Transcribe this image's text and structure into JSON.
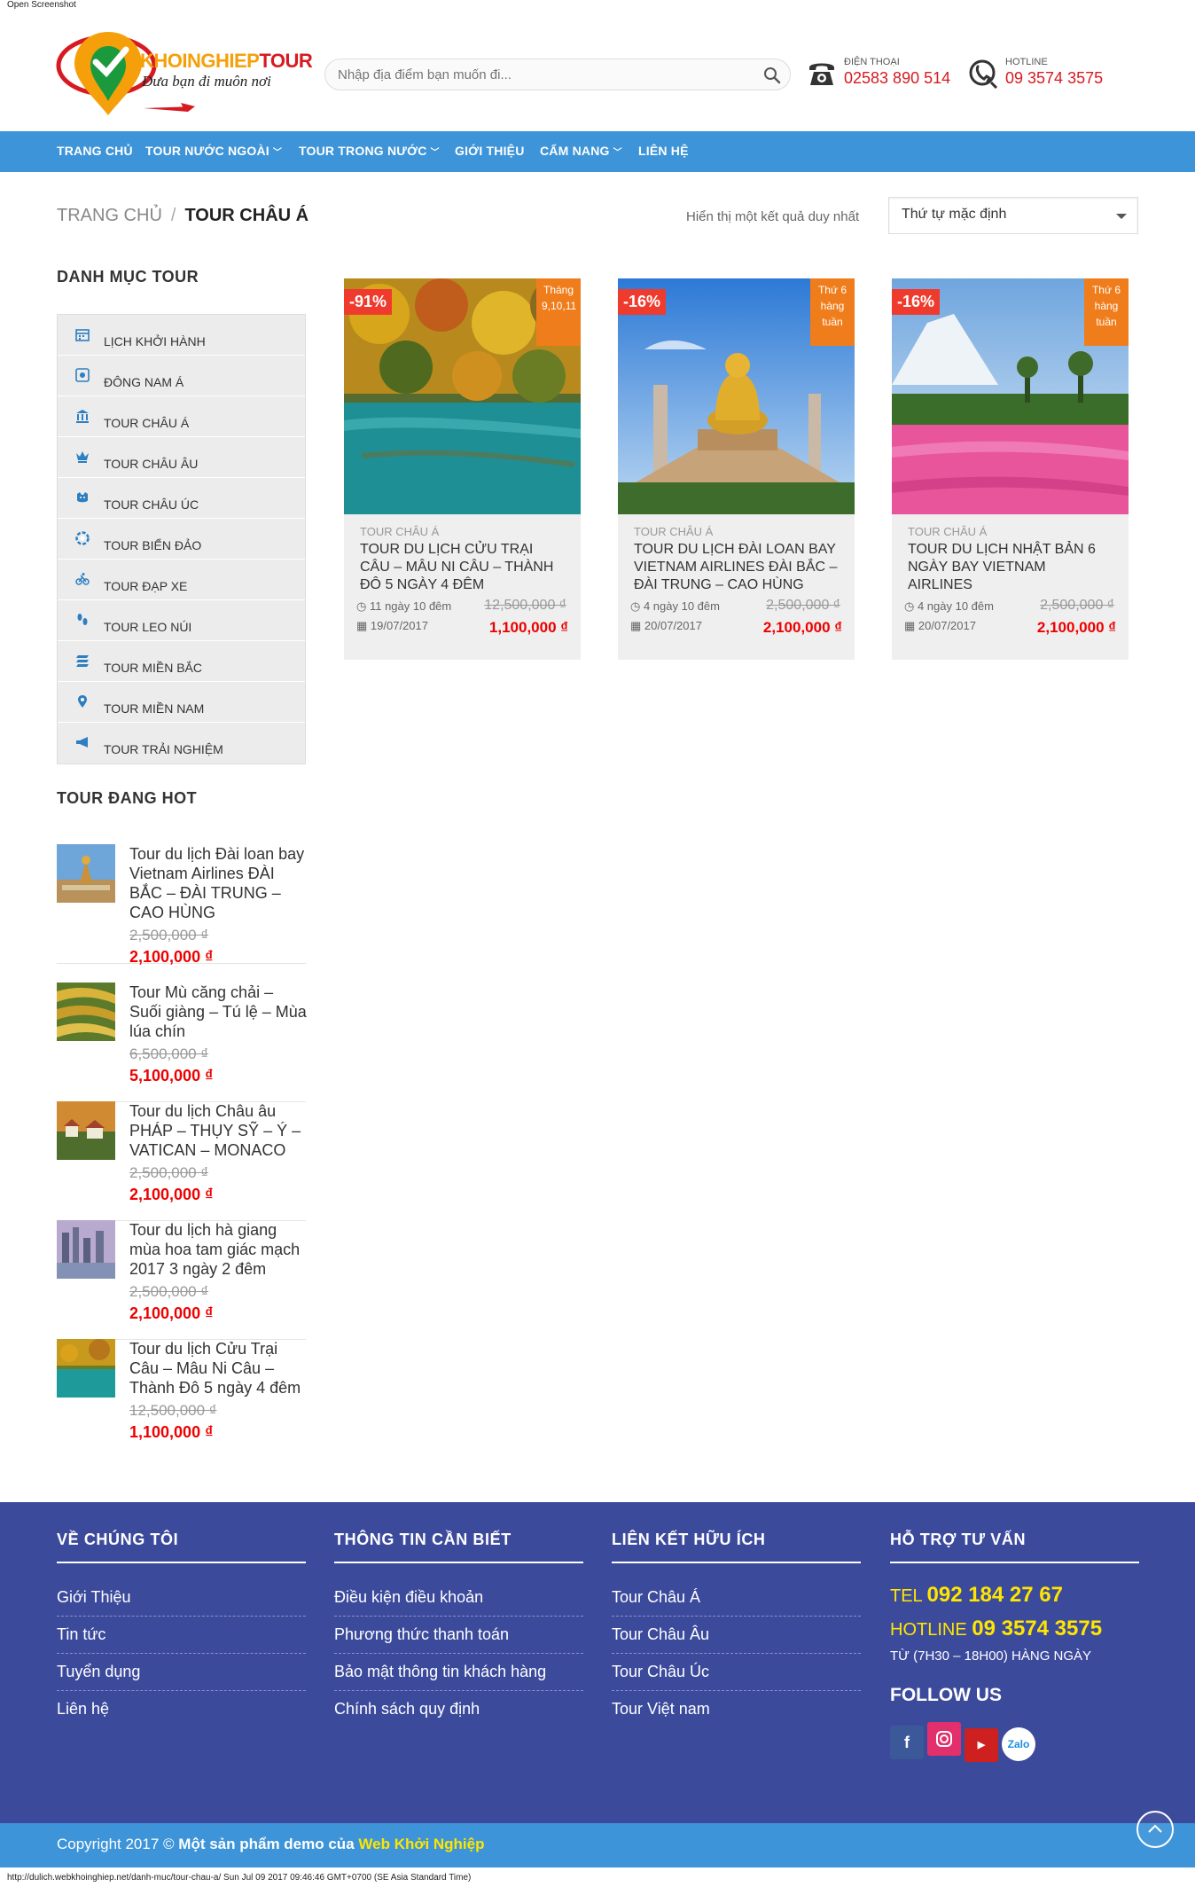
{
  "window": {
    "caption": "Open Screenshot",
    "status_line": "http://dulich.webkhoinghiep.net/danh-muc/tour-chau-a/ Sun Jul 09 2017 09:46:46 GMT+0700 (SE Asia Standard Time)"
  },
  "header": {
    "logo_title_a": "KHOINGHIEP",
    "logo_title_b": "TOUR",
    "logo_slogan": "Đưa bạn đi muôn nơi",
    "search_placeholder": "Nhập địa điểm bạn muốn đi...",
    "phone_label": "ĐIỆN THOẠI",
    "phone_number": "02583 890 514",
    "hotline_label": "HOTLINE",
    "hotline_number": "09 3574 3575"
  },
  "nav": [
    {
      "label": "TRANG CHỦ",
      "dropdown": false
    },
    {
      "label": "TOUR NƯỚC NGOÀI",
      "dropdown": true
    },
    {
      "label": "TOUR TRONG NƯỚC",
      "dropdown": true
    },
    {
      "label": "GIỚI THIỆU",
      "dropdown": false
    },
    {
      "label": "CẨM NANG",
      "dropdown": true
    },
    {
      "label": "LIÊN HỆ",
      "dropdown": false
    }
  ],
  "breadcrumb": {
    "home": "TRANG CHỦ",
    "separator": "/",
    "current": "TOUR CHÂU Á"
  },
  "result_count": "Hiển thị một kết quả duy nhất",
  "sort": {
    "selected": "Thứ tự mặc định"
  },
  "sidebar": {
    "categories_title": "DANH MỤC TOUR",
    "categories": [
      {
        "label": "LỊCH KHỞI HÀNH",
        "icon": "calendar-icon"
      },
      {
        "label": "ĐÔNG NAM Á",
        "icon": "map-pin-square-icon"
      },
      {
        "label": "TOUR CHÂU Á",
        "icon": "bank-icon"
      },
      {
        "label": "TOUR CHÂU ÂU",
        "icon": "crown-icon"
      },
      {
        "label": "TOUR CHÂU ÚC",
        "icon": "kangaroo-icon"
      },
      {
        "label": "TOUR BIỂN ĐẢO",
        "icon": "lifebuoy-icon"
      },
      {
        "label": "TOUR ĐẠP XE",
        "icon": "bicycle-icon"
      },
      {
        "label": "TOUR LEO NÚI",
        "icon": "footprints-icon"
      },
      {
        "label": "TOUR MIỀN BẮC",
        "icon": "layers-icon"
      },
      {
        "label": "TOUR MIỀN NAM",
        "icon": "location-pin-icon"
      },
      {
        "label": "TOUR TRẢI NGHIỆM",
        "icon": "megaphone-icon"
      }
    ],
    "hot_title": "TOUR ĐANG HOT",
    "hot": [
      {
        "title": "Tour du lịch Đài loan bay Vietnam Airlines ĐÀI BẮC – ĐÀI TRUNG – CAO HÙNG",
        "old_price": "2,500,000 ₫",
        "new_price": "2,100,000 ₫"
      },
      {
        "title": "Tour Mù căng chải – Suối giàng – Tú lệ – Mùa lúa chín",
        "old_price": "6,500,000 ₫",
        "new_price": "5,100,000 ₫"
      },
      {
        "title": "Tour du lịch Châu âu PHÁP – THỤY SỸ – Ý – VATICAN – MONACO",
        "old_price": "2,500,000 ₫",
        "new_price": "2,100,000 ₫"
      },
      {
        "title": "Tour du lịch hà giang mùa hoa tam giác mạch 2017 3 ngày 2 đêm",
        "old_price": "2,500,000 ₫",
        "new_price": "2,100,000 ₫"
      },
      {
        "title": "Tour du lịch Cửu Trại Câu – Mâu Ni Câu – Thành Đô 5 ngày 4 đêm",
        "old_price": "12,500,000 ₫",
        "new_price": "1,100,000 ₫"
      }
    ]
  },
  "products": [
    {
      "discount": "-91%",
      "badge": "Tháng 9,10,11",
      "category": "TOUR CHÂU Á",
      "title": "TOUR DU LỊCH CỬU TRẠI CÂU – MÂU NI CÂU – THÀNH ĐÔ 5 NGÀY 4 ĐÊM",
      "duration": "11 ngày 10 đêm",
      "date": "19/07/2017",
      "old_price": "12,500,000 ₫",
      "new_price": "1,100,000 ₫"
    },
    {
      "discount": "-16%",
      "badge": "Thứ 6 hàng tuần",
      "category": "TOUR CHÂU Á",
      "title": "TOUR DU LỊCH ĐÀI LOAN BAY VIETNAM AIRLINES ĐÀI BẮC – ĐÀI TRUNG – CAO HÙNG",
      "duration": "4 ngày 10 đêm",
      "date": "20/07/2017",
      "old_price": "2,500,000 ₫",
      "new_price": "2,100,000 ₫"
    },
    {
      "discount": "-16%",
      "badge": "Thứ 6 hàng tuần",
      "category": "TOUR CHÂU Á",
      "title": "TOUR DU LỊCH NHẬT BẢN 6 NGÀY BAY VIETNAM AIRLINES",
      "duration": "4 ngày 10 đêm",
      "date": "20/07/2017",
      "old_price": "2,500,000 ₫",
      "new_price": "2,100,000 ₫"
    }
  ],
  "footer": {
    "about_title": "VỀ CHÚNG TÔI",
    "about_links": [
      "Giới Thiệu",
      "Tin tức",
      "Tuyển dụng",
      "Liên hệ"
    ],
    "info_title": "THÔNG TIN CẦN BIẾT",
    "info_links": [
      "Điều kiện điều khoản",
      "Phương thức thanh toán",
      "Bảo mật thông tin khách hàng",
      "Chính sách quy định"
    ],
    "links_title": "LIÊN KẾT HỮU ÍCH",
    "useful_links": [
      "Tour Châu Á",
      "Tour Châu Âu",
      "Tour Châu Úc",
      "Tour Việt nam"
    ],
    "support_title": "HỖ TRỢ TƯ VẤN",
    "tel_label": "TEL",
    "tel_number": "092 184 27 67",
    "hotline_label": "HOTLINE",
    "hotline_number": "09 3574 3575",
    "hours": "TỪ (7H30 – 18H00) HÀNG NGÀY",
    "follow_title": "FOLLOW US",
    "social": [
      "facebook-icon",
      "instagram-icon",
      "youtube-icon",
      "zalo-icon"
    ],
    "zalo_label": "Zalo",
    "copyright_a": "Copyright 2017 ©",
    "copyright_b": "Một sản phẩm demo của",
    "copyright_c": "Web Khởi Nghiệp"
  },
  "colors": {
    "nav_blue": "#3d94d8",
    "footer_indigo": "#3c4a9c",
    "sale_red": "#ef3b2d",
    "badge_orange": "#f07d1c",
    "price_red": "#e00000",
    "highlight_yellow": "#ffe600"
  }
}
